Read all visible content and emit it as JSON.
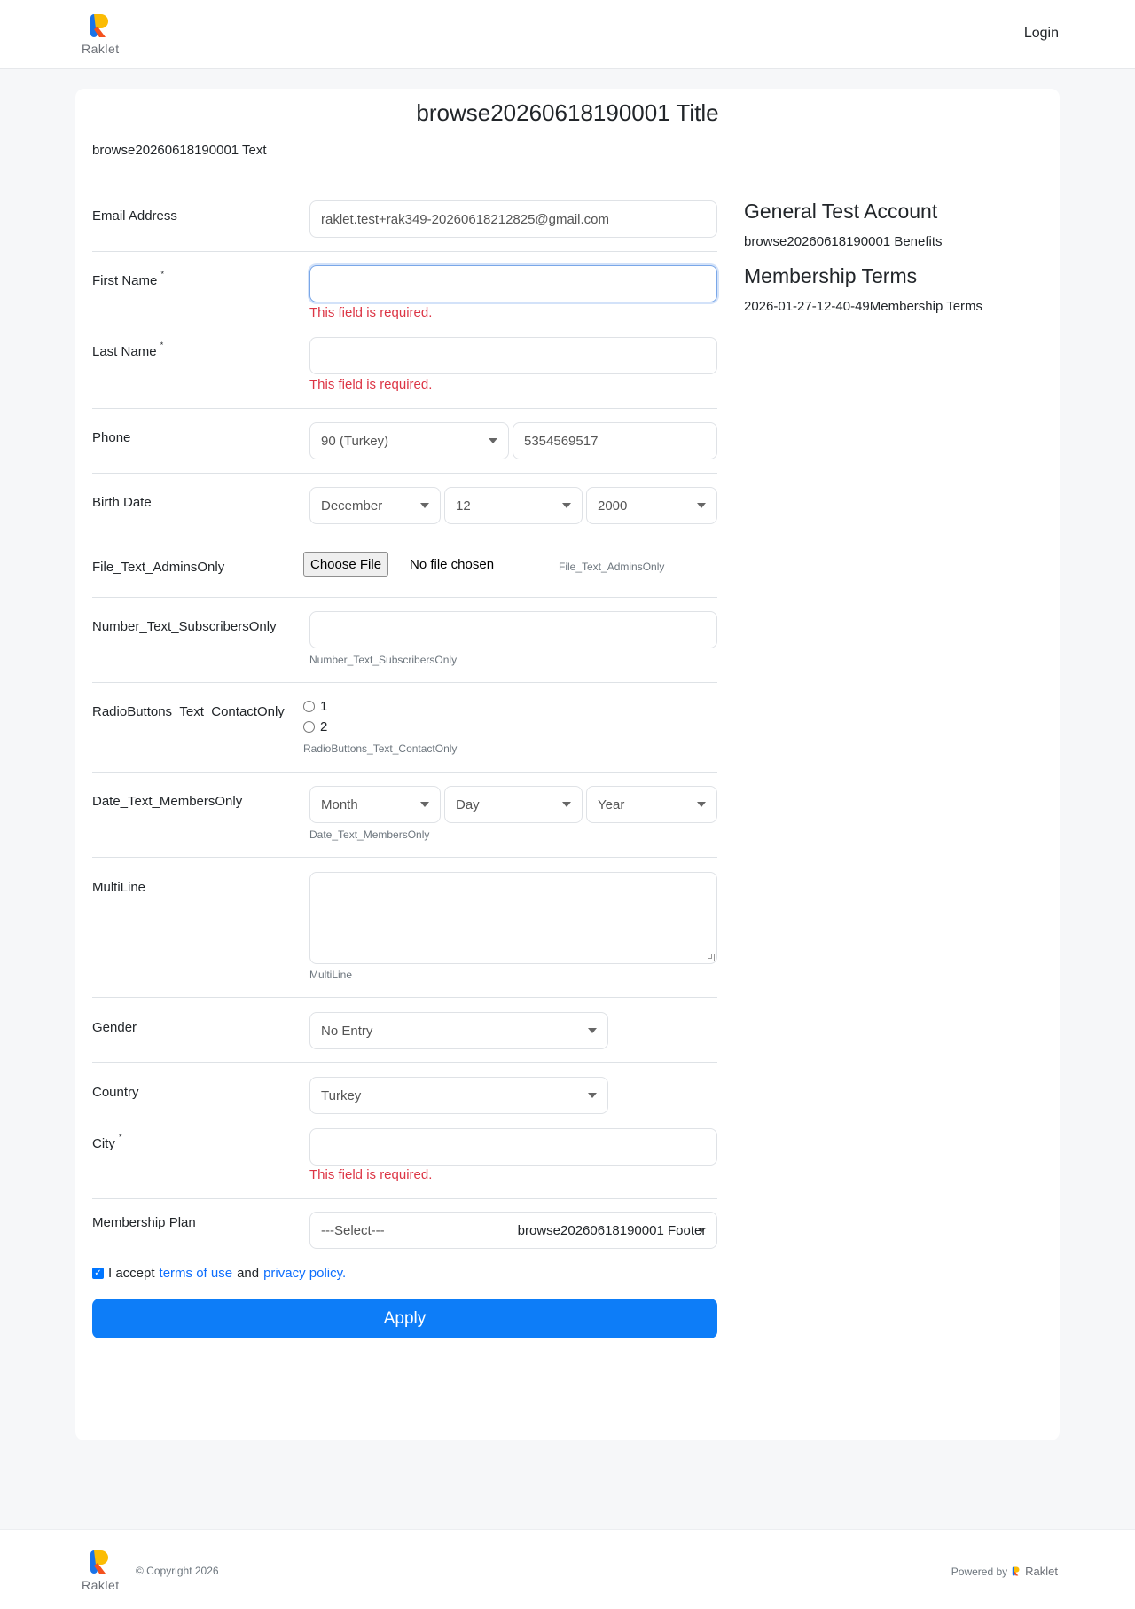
{
  "header": {
    "brand": "Raklet",
    "login_label": "Login"
  },
  "page": {
    "title": "browse20260618190001 Title",
    "text": "browse20260618190001 Text",
    "footer_text": "browse20260618190001 Footer"
  },
  "form": {
    "email": {
      "label": "Email Address",
      "value": "raklet.test+rak349-20260618212825@gmail.com"
    },
    "first_name": {
      "label": "First Name",
      "required_mark": "*",
      "value": "",
      "error": "This field is required."
    },
    "last_name": {
      "label": "Last Name",
      "required_mark": "*",
      "value": "",
      "error": "This field is required."
    },
    "phone": {
      "label": "Phone",
      "country_code": "90 (Turkey)",
      "number": "5354569517"
    },
    "birth_date": {
      "label": "Birth Date",
      "month": "December",
      "day": "12",
      "year": "2000"
    },
    "file_field": {
      "label": "File_Text_AdminsOnly",
      "button": "Choose File",
      "status": "No file chosen",
      "help": "File_Text_AdminsOnly"
    },
    "number_field": {
      "label": "Number_Text_SubscribersOnly",
      "value": "",
      "help": "Number_Text_SubscribersOnly"
    },
    "radio_field": {
      "label": "RadioButtons_Text_ContactOnly",
      "options": [
        "1",
        "2"
      ],
      "help": "RadioButtons_Text_ContactOnly"
    },
    "date_field": {
      "label": "Date_Text_MembersOnly",
      "month": "Month",
      "day": "Day",
      "year": "Year",
      "help": "Date_Text_MembersOnly"
    },
    "multiline": {
      "label": "MultiLine",
      "value": "",
      "help": "MultiLine"
    },
    "gender": {
      "label": "Gender",
      "value": "No Entry"
    },
    "country": {
      "label": "Country",
      "value": "Turkey"
    },
    "city": {
      "label": "City",
      "required_mark": "*",
      "value": "",
      "error": "This field is required."
    },
    "membership_plan": {
      "label": "Membership Plan",
      "value": "---Select---"
    },
    "terms": {
      "prefix": "I accept",
      "terms_link": "terms of use",
      "and": "and",
      "privacy_link": "privacy policy."
    },
    "apply_label": "Apply"
  },
  "side": {
    "account_title": "General Test Account",
    "benefits": "browse20260618190001 Benefits",
    "terms_title": "Membership Terms",
    "terms_text": "2026-01-27-12-40-49Membership Terms"
  },
  "footer": {
    "copyright": "© Copyright 2026",
    "powered_by": "Powered by",
    "brand": "Raklet"
  },
  "colors": {
    "primary": "#0d7df8",
    "error": "#dc3545",
    "link": "#0d6efd",
    "logo_blue": "#1a73e8",
    "logo_orange": "#f4511e"
  }
}
